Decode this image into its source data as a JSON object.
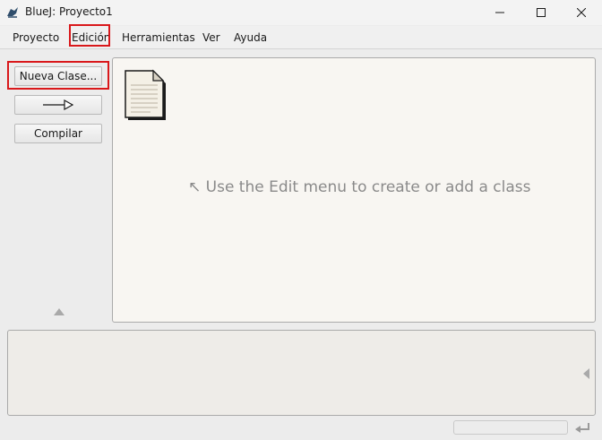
{
  "window": {
    "title": "BlueJ: Proyecto1",
    "controls": [
      "minimize",
      "maximize",
      "close"
    ]
  },
  "menu": {
    "items": [
      {
        "label": "Proyecto"
      },
      {
        "label": "Edición"
      },
      {
        "label": "Herramientas"
      },
      {
        "label": "Ver"
      },
      {
        "label": "Ayuda"
      }
    ]
  },
  "sidebar": {
    "new_class_label": "Nueva Clase...",
    "arrow_icon": "inheritance-arrow-icon",
    "compile_label": "Compilar"
  },
  "canvas": {
    "hint": "↖ Use the Edit menu to create or add a class",
    "readme_icon": "document-icon"
  },
  "highlight_color": "#d9181b"
}
